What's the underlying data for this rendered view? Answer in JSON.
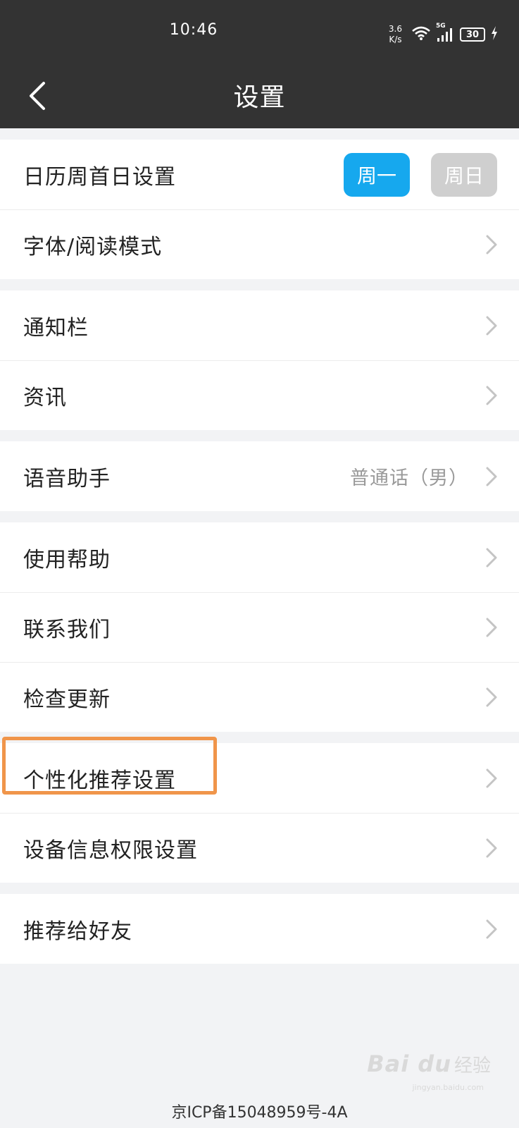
{
  "status_bar": {
    "time": "10:46",
    "net_speed_value": "3.6",
    "net_speed_unit": "K/s",
    "network_type": "5G",
    "battery": "30"
  },
  "header": {
    "title": "设置",
    "back_icon": "chevron-left-icon"
  },
  "settings": {
    "week_start": {
      "label": "日历周首日设置",
      "options": [
        "周一",
        "周日"
      ],
      "selected": "周一"
    },
    "font_mode": "字体/阅读模式",
    "notification_bar": "通知栏",
    "news": "资讯",
    "voice_assistant": {
      "label": "语音助手",
      "value": "普通话（男）"
    },
    "help": "使用帮助",
    "contact": "联系我们",
    "check_update": "检查更新",
    "personalized": "个性化推荐设置",
    "device_permission": "设备信息权限设置",
    "recommend": "推荐给好友"
  },
  "footer": {
    "icp": "京ICP备15048959号-4A"
  },
  "watermark": {
    "logo": "Bai du",
    "text": "经验",
    "sub": "jingyan.baidu.com"
  },
  "colors": {
    "header_bg": "#333333",
    "page_bg": "#f2f3f5",
    "accent": "#16a8ee",
    "highlight": "#f0954a"
  }
}
